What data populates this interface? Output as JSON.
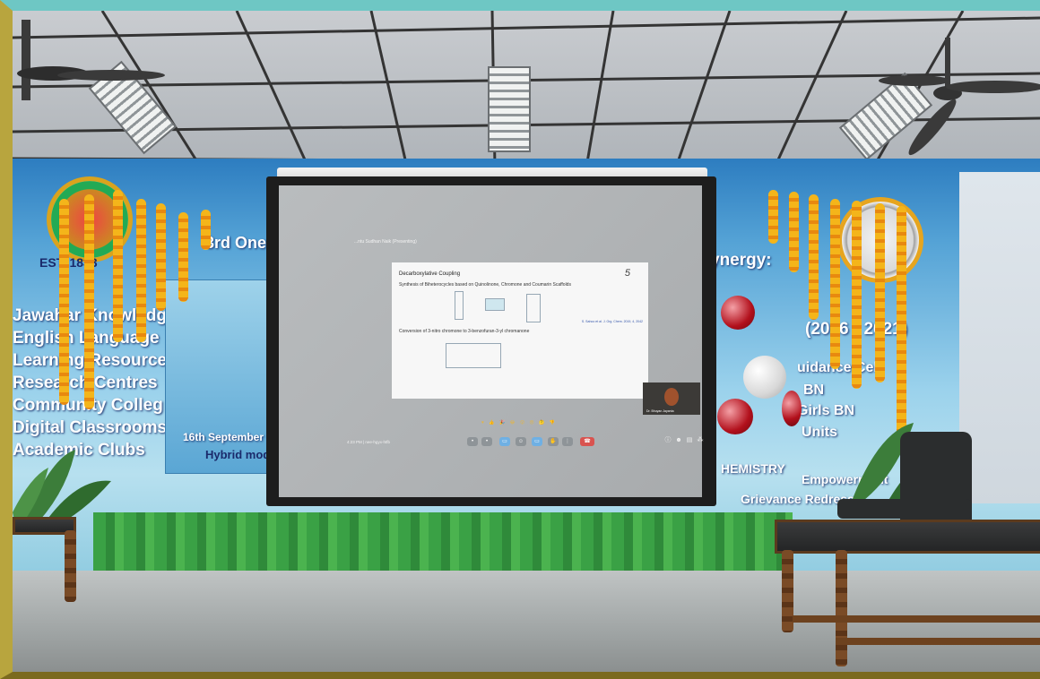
{
  "banner": {
    "left_lines": [
      "Jawahar Knowledg",
      "English Language",
      "Learning Resource",
      "Research Centres",
      "Community Colleg",
      "Digital Classrooms",
      "Academic Clubs"
    ],
    "est_label": "EST. 1833",
    "event_title_fragment": "3rd One D",
    "date_fragment": "16th September",
    "mode_fragment": "Hybrid mod",
    "synergy_fragment": "ynergy:",
    "years_fragment": "(2016 - 2021)",
    "right_lines": [
      "uidance Cell",
      "BN",
      "Girls BN",
      "Units"
    ],
    "chemistry_fragment": "HEMISTRY",
    "empowerment_fragment": "Empowerment",
    "grievance_fragment": "Grievance Redress"
  },
  "projection": {
    "meeting_title": "...ntu Sudhan Naik (Presenting)",
    "slide": {
      "title": "Decarboxylative Coupling",
      "line1": "Synthesis of Biheterocycles based on Quinolinone, Chromone and Coumarin Scaffolds",
      "line2": "Conversion of 3-nitro chromone to 3-benzofuran-3-yl chromanone",
      "page_number": "5",
      "reference": "S. Sahoo et al. J. Org. Chem. 2019, 4, 2042"
    },
    "video_participant": "Dr. Bhuyan Jayanta",
    "taskbar_time": "4:23 PM  |  nee-hgyx-htfb",
    "reactions": "♥ 👍 🎉 😂 😮 😢 🤔 👎",
    "controls": [
      "mic",
      "camera",
      "captions",
      "emoji",
      "present",
      "raise-hand",
      "more",
      "end-call"
    ]
  },
  "colors": {
    "frame_top": "#6ec7c4",
    "frame_left": "#b8a53e",
    "banner_blue": "#2d7dc0",
    "screen_black": "#1d1d1d",
    "projection_gray": "#b1b4b6"
  }
}
